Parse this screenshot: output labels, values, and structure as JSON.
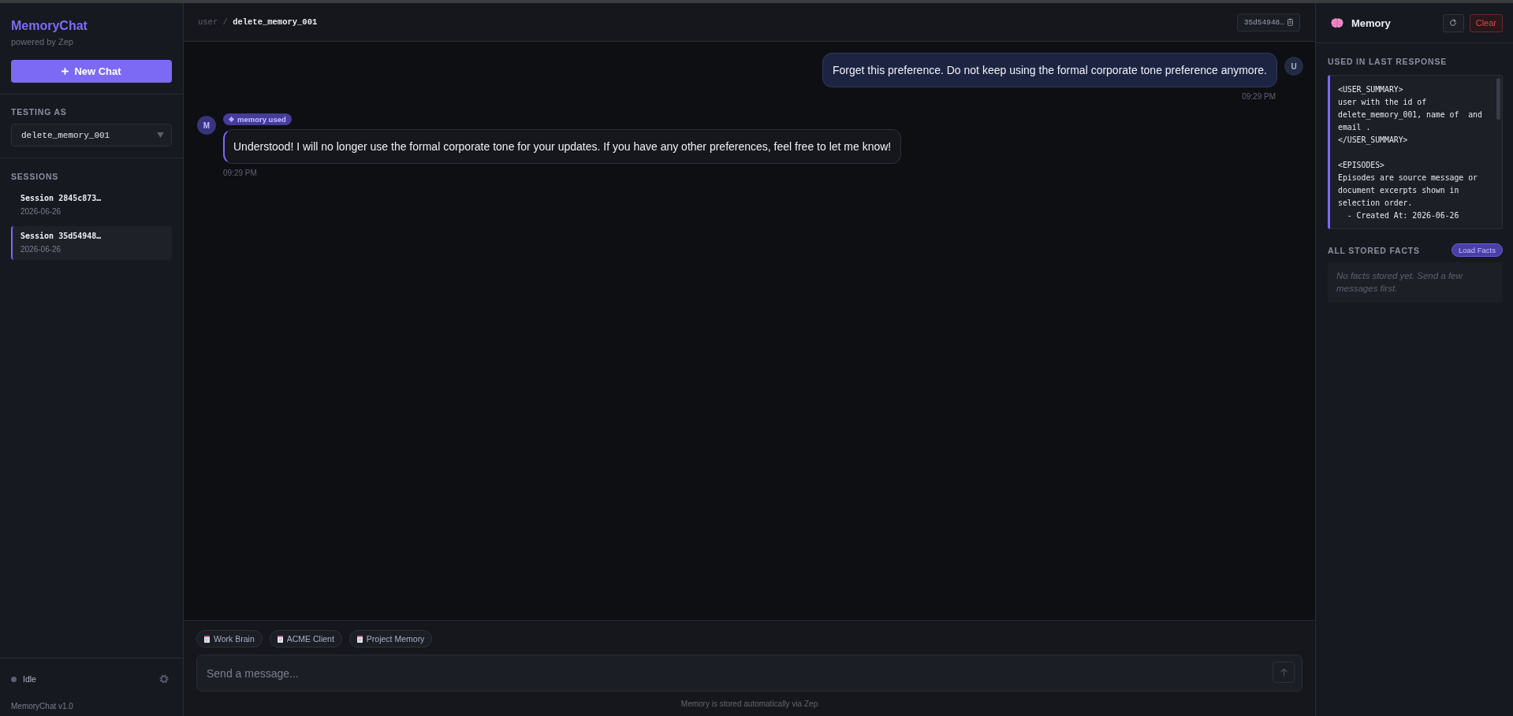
{
  "sidebar": {
    "brand": "MemoryChat",
    "tagline": "powered by Zep",
    "new_chat_label": "New Chat",
    "testing_label": "TESTING AS",
    "testing_value": "delete_memory_001",
    "sessions_label": "SESSIONS",
    "sessions": [
      {
        "name": "Session 2845c873…",
        "date": "2026-06-26",
        "selected": false
      },
      {
        "name": "Session 35d54948…",
        "date": "2026-06-26",
        "selected": true
      }
    ],
    "status": {
      "label": "Idle",
      "active": false
    },
    "version": "MemoryChat v1.0"
  },
  "chat": {
    "header": {
      "prefix": "user",
      "separator": "/",
      "user_id": "delete_memory_001",
      "session_id": "35d54948…"
    },
    "messages": [
      {
        "kind": "user",
        "avatar": "U",
        "text": "Forget this preference. Do not keep using the formal corporate tone preference anymore.",
        "time": "09:29 PM"
      },
      {
        "kind": "assistant",
        "avatar": "M",
        "badge": "memory used",
        "text": "Understood! I will no longer use the formal corporate tone for your updates. If you have any other preferences, feel free to let me know!",
        "time": "09:29 PM"
      }
    ]
  },
  "composer": {
    "chips": [
      "Work Brain",
      "ACME Client",
      "Project Memory"
    ],
    "placeholder": "Send a message...",
    "send_disabled": true,
    "note": "Memory is stored automatically via Zep"
  },
  "memory_panel": {
    "title": "Memory",
    "clear_label": "Clear",
    "used_label": "USED IN LAST RESPONSE",
    "context": "<USER_SUMMARY>\nuser with the id of delete_memory_001, name of  and email .\n</USER_SUMMARY>\n\n<EPISODES>\nEpisodes are source message or document excerpts shown in selection order.\n  - Created At: 2026-06-26",
    "facts_label": "ALL STORED FACTS",
    "load_label": "Load Facts",
    "empty_text": "No facts stored yet. Send a few messages first."
  }
}
